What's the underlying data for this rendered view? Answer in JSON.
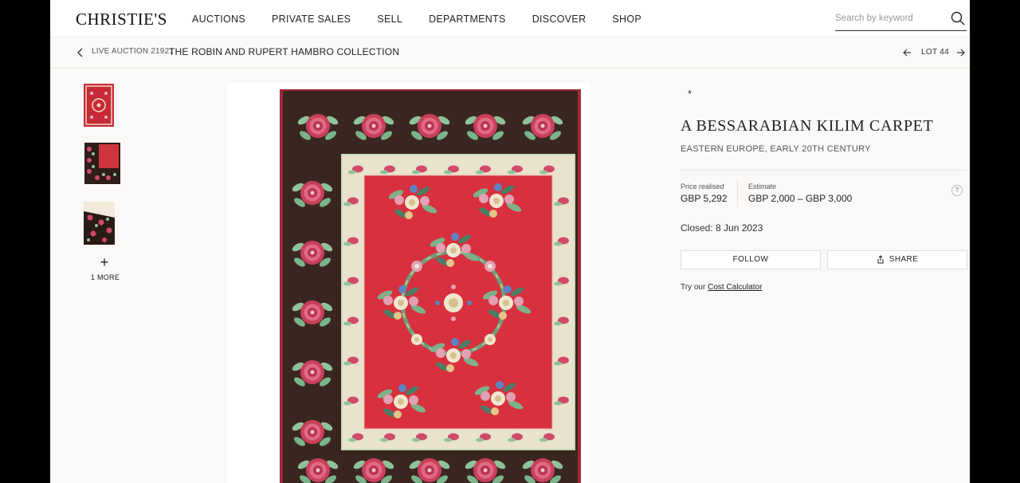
{
  "header": {
    "logo": "CHRISTIE'S",
    "nav": [
      "AUCTIONS",
      "PRIVATE SALES",
      "SELL",
      "DEPARTMENTS",
      "DISCOVER",
      "SHOP"
    ],
    "search_placeholder": "Search by keyword"
  },
  "breadcrumb": {
    "auction": "LIVE AUCTION 21921",
    "title": "THE ROBIN AND RUPERT HAMBRO COLLECTION",
    "lot": "LOT 44"
  },
  "gallery": {
    "more_symbol": "+",
    "more_label": "1 MORE"
  },
  "lot": {
    "symbol": "*",
    "title": "A BESSARABIAN KILIM CARPET",
    "subtitle": "EASTERN EUROPE, EARLY 20TH CENTURY",
    "price_label": "Price realised",
    "price_value": "GBP 5,292",
    "estimate_label": "Estimate",
    "estimate_value": "GBP 2,000 – GBP 3,000",
    "help": "?",
    "closed": "Closed: 8 Jun 2023",
    "follow_label": "FOLLOW",
    "share_label": "SHARE",
    "calc_prefix": "Try our",
    "calc_link": "Cost Calculator"
  },
  "colors": {
    "carpet_red": "#d8303e",
    "carpet_border": "#3a2620",
    "carpet_cream": "#e9e2cc",
    "leaf_green": "#8fc29a",
    "rose_pink": "#d14a68"
  }
}
